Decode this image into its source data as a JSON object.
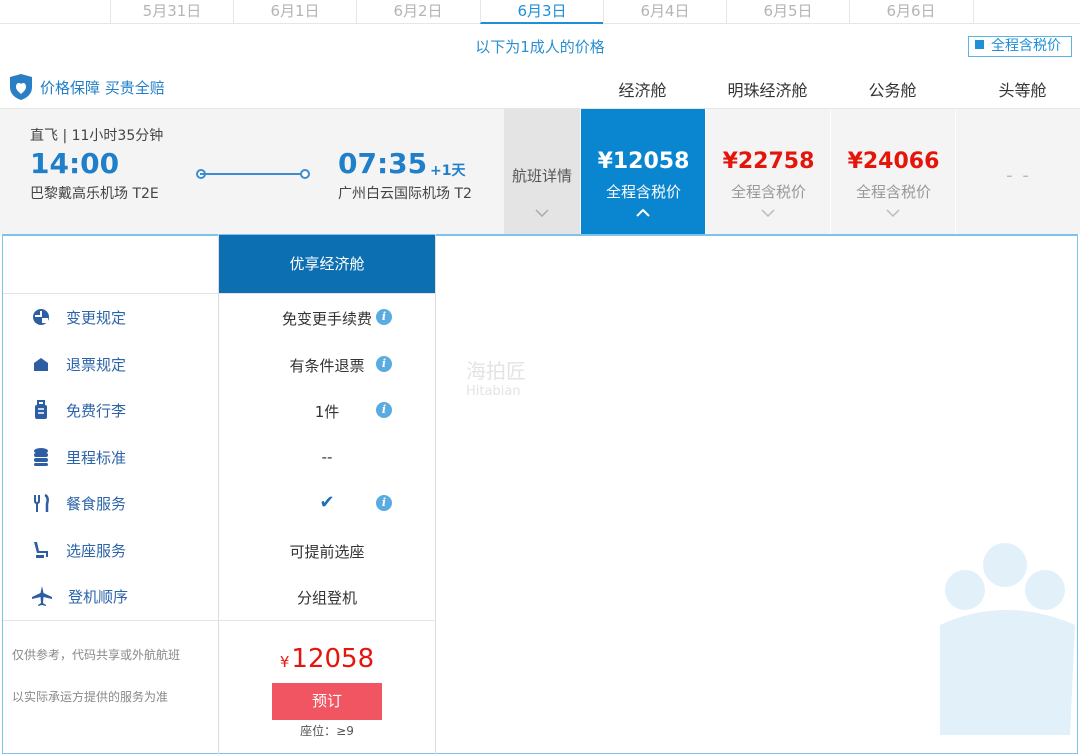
{
  "dates": [
    {
      "label": "5月31日",
      "active": false
    },
    {
      "label": "6月1日",
      "active": false
    },
    {
      "label": "6月2日",
      "active": false
    },
    {
      "label": "6月3日",
      "active": true
    },
    {
      "label": "6月4日",
      "active": false
    },
    {
      "label": "6月5日",
      "active": false
    },
    {
      "label": "6月6日",
      "active": false
    }
  ],
  "notice": "以下为1成人的价格",
  "tax_toggle_label": "全程含税价",
  "guarantee_label": "价格保障 买贵全赔",
  "cabins": [
    "经济舱",
    "明珠经济舱",
    "公务舱",
    "头等舱"
  ],
  "flight": {
    "type": "直飞 | 11小时35分钟",
    "dep_time": "14:00",
    "dep_airport": "巴黎戴高乐机场 T2E",
    "arr_time": "07:35",
    "arr_plus": "+1天",
    "arr_airport": "广州白云国际机场 T2",
    "detail_label": "航班详情",
    "prices": [
      {
        "value": "¥12058",
        "sub": "全程含税价"
      },
      {
        "value": "¥22758",
        "sub": "全程含税价"
      },
      {
        "value": "¥24066",
        "sub": "全程含税价"
      },
      {
        "value": "- -",
        "sub": ""
      }
    ]
  },
  "fare_name": "优享经济舱",
  "features": [
    {
      "label": "变更规定",
      "value": "免变更手续费",
      "icon": "change-icon",
      "info": true
    },
    {
      "label": "退票规定",
      "value": "有条件退票",
      "icon": "refund-icon",
      "info": true
    },
    {
      "label": "免费行李",
      "value": "1件",
      "icon": "luggage-icon",
      "info": true
    },
    {
      "label": "里程标准",
      "value": "--",
      "icon": "mileage-icon",
      "info": false
    },
    {
      "label": "餐食服务",
      "value": "✔",
      "icon": "meal-icon",
      "info": true
    },
    {
      "label": "选座服务",
      "value": "可提前选座",
      "icon": "seat-icon",
      "info": false
    },
    {
      "label": "登机顺序",
      "value": "分组登机",
      "icon": "plane-icon",
      "info": false
    }
  ],
  "notes": [
    "仅供参考，代码共享或外航航班",
    "以实际承运方提供的服务为准"
  ],
  "fare_price_symbol": "¥",
  "fare_price": "12058",
  "book_label": "预订",
  "seats_label": "座位：≥9",
  "watermark": {
    "cn": "海拍匠",
    "en": "Hitabian"
  },
  "colors": {
    "accent": "#0a85cf",
    "price_red": "#e4150b",
    "book_button": "#f05561",
    "fare_header": "#0c6fb2"
  }
}
